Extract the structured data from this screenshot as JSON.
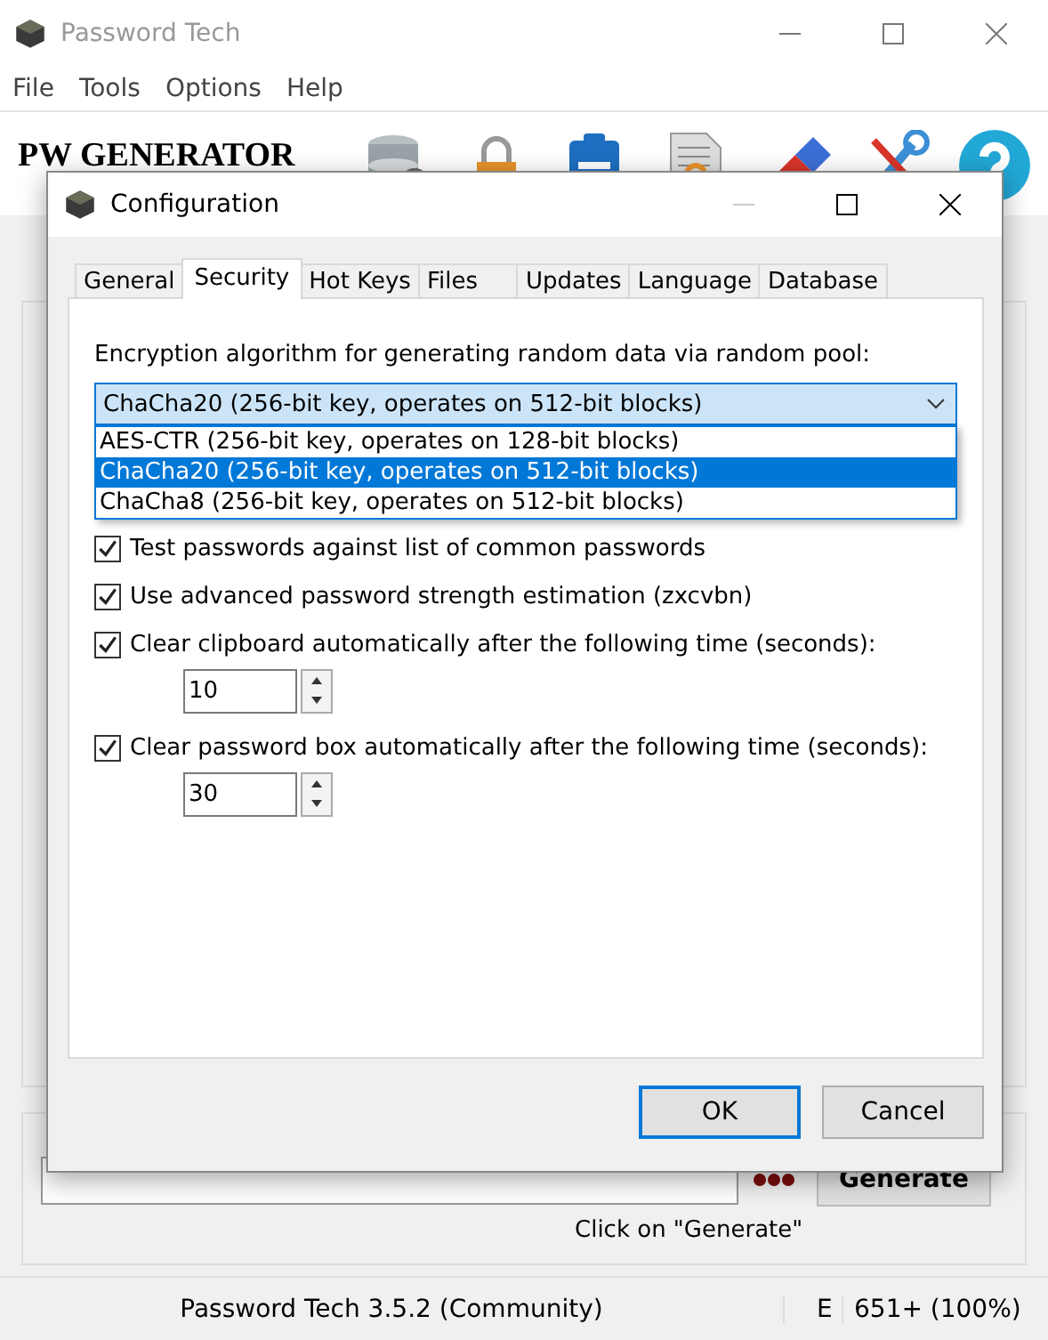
{
  "window": {
    "title": "Password Tech"
  },
  "menu": [
    "File",
    "Tools",
    "Options",
    "Help"
  ],
  "header": {
    "title": "PW GENERATOR"
  },
  "generate_button": "Generate",
  "hint": "Click on \"Generate\"",
  "status_bar": [
    "Password Tech 3.5.2 (Community)",
    "E",
    "651+ (100%)"
  ],
  "dialog": {
    "title": "Configuration",
    "tabs": [
      {
        "label": "General",
        "selected": false
      },
      {
        "label": "Security",
        "selected": true
      },
      {
        "label": "Hot Keys",
        "selected": false
      },
      {
        "label": "Files",
        "selected": false
      },
      {
        "label": "Updates",
        "selected": false
      },
      {
        "label": "Language",
        "selected": false
      },
      {
        "label": "Database",
        "selected": false
      }
    ],
    "algorithm_label": "Encryption algorithm for generating random data via random pool:",
    "algorithm_value": "ChaCha20 (256-bit key, operates on 512-bit blocks)",
    "algorithm_options": [
      {
        "label": "AES-CTR (256-bit key, operates on 128-bit blocks)",
        "selected": false
      },
      {
        "label": "ChaCha20 (256-bit key, operates on 512-bit blocks)",
        "selected": true
      },
      {
        "label": "ChaCha8 (256-bit key, operates on 512-bit blocks)",
        "selected": false
      }
    ],
    "options": [
      {
        "kind": "checkbox",
        "label": "Test passwords against list of common passwords",
        "checked": true
      },
      {
        "kind": "checkbox",
        "label": "Use advanced password strength estimation (zxcvbn)",
        "checked": true
      },
      {
        "kind": "checkbox",
        "label": "Clear clipboard automatically after the following time (seconds):",
        "checked": true
      },
      {
        "kind": "spinner",
        "value": "10"
      },
      {
        "kind": "checkbox",
        "label": "Clear password box automatically after the following time (seconds):",
        "checked": true
      },
      {
        "kind": "spinner",
        "value": "30"
      }
    ],
    "buttons": [
      {
        "label": "OK",
        "default": true
      },
      {
        "label": "Cancel",
        "default": false
      }
    ]
  }
}
